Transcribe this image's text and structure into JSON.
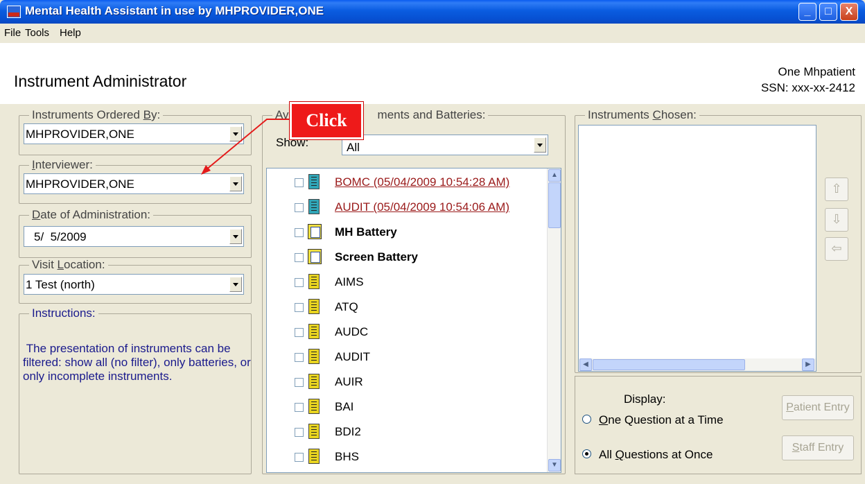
{
  "window": {
    "title": "Mental Health Assistant in use by MHPROVIDER,ONE",
    "min": "_",
    "max": "□",
    "close": "X"
  },
  "menu": {
    "file": "File",
    "tools": "Tools",
    "help": "Help"
  },
  "header": {
    "title": "Instrument Administrator",
    "patient_name": "One Mhpatient",
    "patient_ssn": "SSN: xxx-xx-2412"
  },
  "left": {
    "ordered_by": {
      "label_pre": "Instruments Ordered ",
      "label_ul": "B",
      "label_post": "y:",
      "value": "MHPROVIDER,ONE"
    },
    "interviewer": {
      "label_ul": "I",
      "label_post": "nterviewer:",
      "value": "MHPROVIDER,ONE"
    },
    "date": {
      "label_ul": "D",
      "label_post": "ate of Administration:",
      "value": "5/  5/2009"
    },
    "location": {
      "label_pre": "Visit ",
      "label_ul": "L",
      "label_post": "ocation:",
      "value": "1 Test (north)"
    },
    "instructions": {
      "label": "Instructions:",
      "text": " The presentation of instruments can be filtered: show all (no filter), only batteries, or only incomplete instruments."
    }
  },
  "middle": {
    "label_pre": "Av",
    "label_post": "ments and Batteries:",
    "show_label": "Show:",
    "show_value": "All",
    "items": [
      {
        "label": "BOMC  (05/04/2009 10:54:28 AM)",
        "kind": "done"
      },
      {
        "label": "AUDIT  (05/04/2009 10:54:06 AM)",
        "kind": "done"
      },
      {
        "label": "MH Battery",
        "kind": "battery"
      },
      {
        "label": "Screen Battery",
        "kind": "battery"
      },
      {
        "label": "AIMS",
        "kind": "instrument"
      },
      {
        "label": "ATQ",
        "kind": "instrument"
      },
      {
        "label": "AUDC",
        "kind": "instrument"
      },
      {
        "label": "AUDIT",
        "kind": "instrument"
      },
      {
        "label": "AUIR",
        "kind": "instrument"
      },
      {
        "label": "BAI",
        "kind": "instrument"
      },
      {
        "label": "BDI2",
        "kind": "instrument"
      },
      {
        "label": "BHS",
        "kind": "instrument"
      }
    ]
  },
  "right": {
    "label_pre": "Instruments ",
    "label_ul": "C",
    "label_post": "hosen:",
    "display_label": "Display:",
    "one_q": {
      "ul": "O",
      "rest": "ne Question at a Time"
    },
    "all_q": {
      "pre": "All ",
      "ul": "Q",
      "rest": "uestions at Once"
    },
    "patient_entry": {
      "ul": "P",
      "rest": "atient Entry"
    },
    "staff_entry": {
      "ul": "S",
      "rest": "taff Entry"
    }
  },
  "annotation": {
    "callout": "Click"
  }
}
